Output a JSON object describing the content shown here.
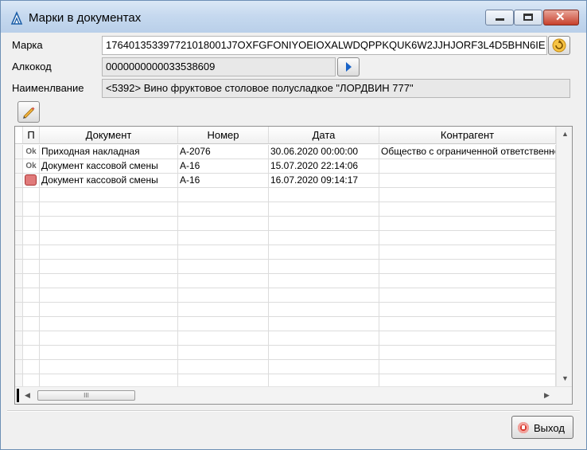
{
  "window": {
    "title": "Марки в документах"
  },
  "form": {
    "marka_label": "Марка",
    "marka_value": "176401353397721018001J7OXFGFONIYOEIOXALWDQPPKQUK6W2JJHJORF3L4D5BHN6IE",
    "alkokod_label": "Алкокод",
    "alkokod_value": "0000000000033538609",
    "naim_label": "Наименлвание",
    "naim_value": "<5392> Вино фруктовое столовое полусладкое \"ЛОРДВИН 777\""
  },
  "table": {
    "columns": [
      "П",
      "Документ",
      "Номер",
      "Дата",
      "Контрагент"
    ],
    "rows": [
      {
        "status": "ok",
        "status_text": "Ok",
        "doc": "Приходная накладная",
        "num": "А-2076",
        "date": "30.06.2020 00:00:00",
        "agent": "Общество с ограниченной ответственностью"
      },
      {
        "status": "ok",
        "status_text": "Ok",
        "doc": "Документ кассовой смены",
        "num": "А-16",
        "date": "15.07.2020 22:14:06",
        "agent": ""
      },
      {
        "status": "error",
        "status_text": "",
        "doc": "Документ кассовой смены",
        "num": "А-16",
        "date": "16.07.2020 09:14:17",
        "agent": ""
      }
    ],
    "hscroll_thumb": "III"
  },
  "footer": {
    "exit_label": "Выход"
  },
  "colors": {
    "error_status": "#e07a7a",
    "accent_blue": "#1a64c8"
  }
}
